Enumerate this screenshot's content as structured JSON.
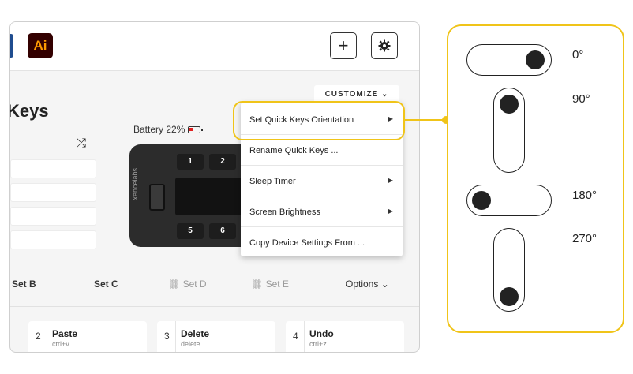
{
  "app": {
    "logo_text": "Ai",
    "add_label": "+",
    "customize_label": "CUSTOMIZE ⌄",
    "title": "Keys",
    "battery_text": "Battery 22%",
    "shuffle_glyph": "⤮"
  },
  "device": {
    "brand": "xencelabs",
    "keys_top": [
      "1",
      "2"
    ],
    "keys_bottom": [
      "5",
      "6"
    ]
  },
  "tabs": [
    {
      "label": "Set B",
      "enabled": true
    },
    {
      "label": "Set C",
      "enabled": true
    },
    {
      "label": "⛓ Set D",
      "enabled": false
    },
    {
      "label": "⛓ Set E",
      "enabled": false
    }
  ],
  "options_label": "Options ⌄",
  "key_cards": [
    {
      "num": "2",
      "name": "Paste",
      "shortcut": "ctrl+v"
    },
    {
      "num": "3",
      "name": "Delete",
      "shortcut": "delete"
    },
    {
      "num": "4",
      "name": "Undo",
      "shortcut": "ctrl+z"
    }
  ],
  "menu": {
    "items": [
      {
        "label": "Set Quick Keys Orientation",
        "arrow": "▶"
      },
      {
        "label": "Rename Quick Keys ...",
        "arrow": ""
      },
      {
        "label": "Sleep Timer",
        "arrow": "▶"
      },
      {
        "label": "Screen Brightness",
        "arrow": "▶"
      },
      {
        "label": "Copy Device Settings From ...",
        "arrow": ""
      }
    ]
  },
  "orientations": [
    {
      "label": "0°"
    },
    {
      "label": "90°"
    },
    {
      "label": "180°"
    },
    {
      "label": "270°"
    }
  ],
  "colors": {
    "highlight": "#f0c419",
    "ai_bg": "#330000",
    "ai_fg": "#ff9a00",
    "battery_low": "#e02020"
  }
}
